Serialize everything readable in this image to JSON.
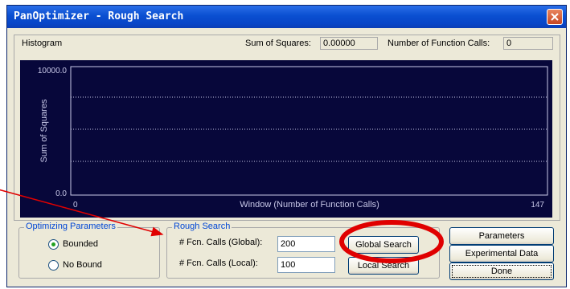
{
  "window": {
    "title": "PanOptimizer - Rough Search"
  },
  "histogram": {
    "label": "Histogram",
    "sum_of_squares_label": "Sum of Squares:",
    "sum_of_squares_value": "0.00000",
    "function_calls_label": "Number of Function Calls:",
    "function_calls_value": "0"
  },
  "chart_data": {
    "type": "line",
    "ylabel": "Sum of Squares",
    "xlabel": "Window (Number of Function Calls)",
    "y_max_label": "10000.0",
    "y_min_label": "0.0",
    "x_min_label": "0",
    "x_max_label": "147",
    "ylim": [
      0,
      10000
    ],
    "xlim": [
      0,
      147
    ],
    "grid": "dotted horizontal",
    "series": [],
    "colors": {
      "background": "#07073a",
      "axis": "#c8c8e8",
      "grid": "#c8c8e8",
      "text": "#c8c8e8"
    }
  },
  "optimizing_parameters": {
    "title": "Optimizing Parameters",
    "bounded_label": "Bounded",
    "no_bound_label": "No Bound",
    "selected": "Bounded"
  },
  "rough_search": {
    "title": "Rough Search",
    "global_label": "# Fcn. Calls (Global):",
    "global_value": "200",
    "local_label": "# Fcn. Calls (Local):",
    "local_value": "100",
    "global_button": "Global Search",
    "local_button": "Local Search"
  },
  "side_buttons": {
    "parameters": "Parameters",
    "experimental_data": "Experimental Data",
    "done": "Done"
  },
  "annotation": {
    "color": "#e00000"
  }
}
